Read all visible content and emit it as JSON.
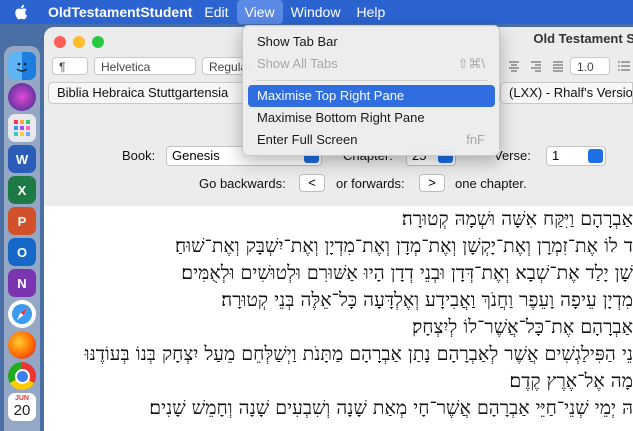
{
  "menubar": {
    "app_name": "OldTestamentStudent",
    "items": [
      "Edit",
      "View",
      "Window",
      "Help"
    ],
    "active": "View"
  },
  "window": {
    "title": "Old Testament S",
    "toolbar": {
      "paragraph_style": "¶",
      "font_family": "Helvetica",
      "font_style": "Regular",
      "line_spacing": "1.0"
    },
    "tabs": [
      "Biblia Hebraica Stuttgartensia",
      "(LXX) - Rhalf's Version"
    ]
  },
  "navigation": {
    "book_label": "Book:",
    "book_value": "Genesis",
    "chapter_label": "Chapter:",
    "chapter_value": "25",
    "verse_label": "Verse:",
    "verse_value": "1",
    "go_backwards_label": "Go backwards:",
    "back_button": "<",
    "or_forwards_label": "or forwards:",
    "forward_button": ">",
    "one_chapter_label": "one chapter."
  },
  "verses": [
    "אַבְרָהָם וַיִּקַּח אִשָּׁה וּשְׁמָהּ קְטוּרָה׃",
    "ד לוֹ אֶת־זִמְרָן וְאֶת־יָקְשָׁן וְאֶת־מְדָן וְאֶת־מִדְיָן וְאֶת־יִשְׁבָּק וְאֶת־שׁוּחַ׃",
    "שָׁן יָלַד אֶת־שְׁבָא וְאֶת־דְּדָן וּבְנֵי דְדָן הָיוּ אַשּׁוּרִם וּלְטוּשִׁים וּלְאֻמִּים׃",
    "מִדְיָן עֵיפָה וָעֵפֶר וַחֲנֹךְ וַאֲבִידָע וְאֶלְדָּעָה כָּל־אֵלֶּה בְּנֵי קְטוּרָה׃",
    "אַבְרָהָם אֶת־כָּל־אֲשֶׁר־לוֹ לְיִצְחָק׃",
    "נֵי הַפִּילַגְשִׁים אֲשֶׁר לְאַבְרָהָם נָתַן אַבְרָהָם מַתָּנֹת וַיְשַׁלְּחֵם מֵעַל יִצְחָק בְּנוֹ בְּעוֹדֶנּוּ",
    "מָה אֶל־אֶרֶץ קֶדֶם׃",
    "הּ יְמֵי שְׁנֵי־חַיֵּי אַבְרָהָם אֲשֶׁר־חָי מְאַת שָׁנָה וְשִׁבְעִים שָׁנָה וְחָמֵשׁ שָׁנִים׃"
  ],
  "view_menu": {
    "items": [
      {
        "label": "Show Tab Bar",
        "shortcut": "",
        "enabled": true
      },
      {
        "label": "Show All Tabs",
        "shortcut": "⇧⌘\\",
        "enabled": false
      },
      {
        "label": "Maximise Top Right Pane",
        "shortcut": "",
        "enabled": true,
        "highlighted": true
      },
      {
        "label": "Maximise Bottom Right Pane",
        "shortcut": "",
        "enabled": true
      },
      {
        "label": "Enter Full Screen",
        "shortcut": "fnF",
        "enabled": true
      }
    ]
  },
  "dock": {
    "icons": [
      "finder-icon",
      "siri-icon",
      "launchpad-icon",
      "word-icon",
      "excel-icon",
      "powerpoint-icon",
      "outlook-icon",
      "onenote-icon",
      "safari-icon",
      "firefox-icon",
      "chrome-icon",
      "calendar-icon"
    ],
    "calendar_month": "JUN",
    "calendar_day": "20"
  },
  "colors": {
    "menubar": "#2b63d1",
    "highlight": "#2f6de0",
    "accent": "#1f6fe5"
  }
}
